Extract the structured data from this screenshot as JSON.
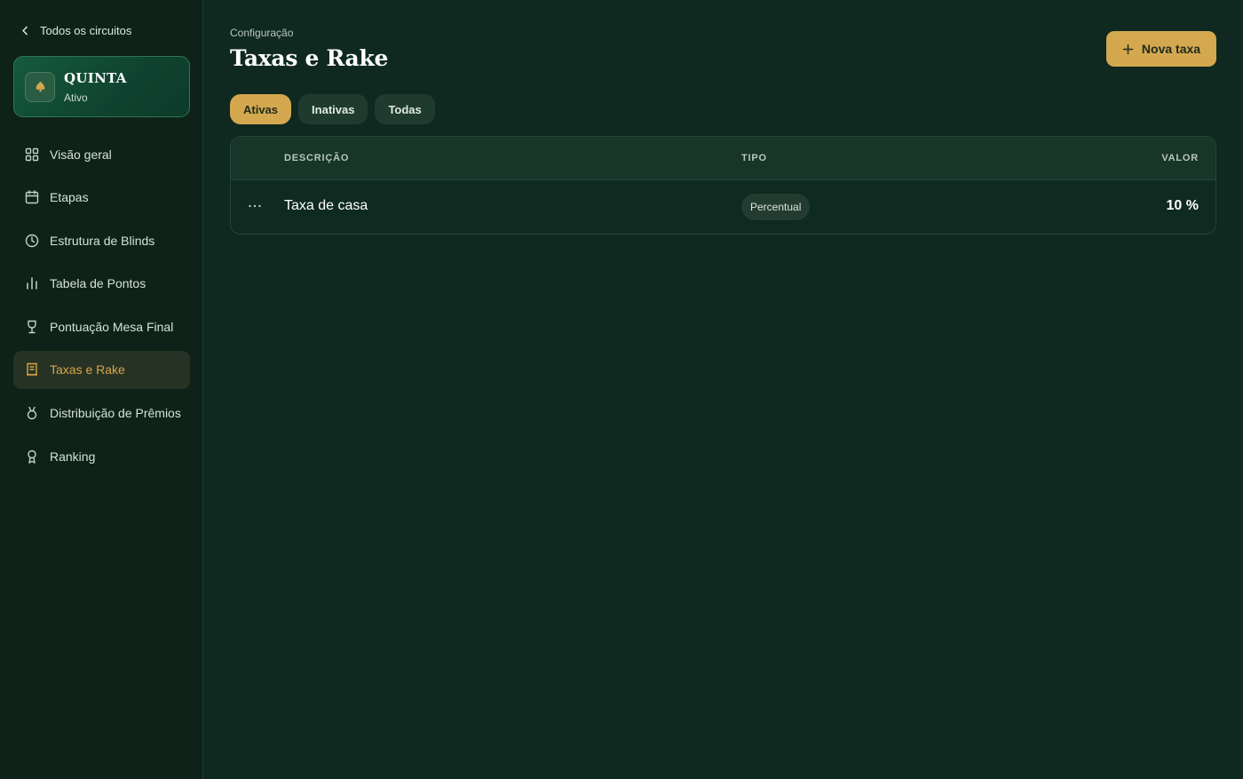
{
  "sidebar": {
    "back_label": "Todos os circuitos",
    "circuit": {
      "name": "QUINTA",
      "status": "Ativo",
      "icon": "spade-icon"
    },
    "items": [
      {
        "label": "Visão geral",
        "icon": "grid-icon"
      },
      {
        "label": "Etapas",
        "icon": "calendar-icon"
      },
      {
        "label": "Estrutura de Blinds",
        "icon": "clock-icon"
      },
      {
        "label": "Tabela de Pontos",
        "icon": "bar-chart-icon"
      },
      {
        "label": "Pontuação Mesa Final",
        "icon": "goblet-icon"
      },
      {
        "label": "Taxas e Rake",
        "icon": "receipt-icon",
        "active": true
      },
      {
        "label": "Distribuição de Prêmios",
        "icon": "medal-icon"
      },
      {
        "label": "Ranking",
        "icon": "award-icon"
      }
    ]
  },
  "header": {
    "breadcrumb": "Configuração",
    "title": "Taxas e Rake",
    "new_button": "Nova taxa"
  },
  "tabs": [
    {
      "label": "Ativas",
      "active": true
    },
    {
      "label": "Inativas"
    },
    {
      "label": "Todas"
    }
  ],
  "table": {
    "columns": {
      "description": "DESCRIÇÃO",
      "type": "TIPO",
      "value": "VALOR"
    },
    "rows": [
      {
        "description": "Taxa de casa",
        "type": "Percentual",
        "value": "10 %"
      }
    ]
  },
  "colors": {
    "accent": "#d4a84e",
    "background": "#0f2920",
    "sidebar": "#0e2219",
    "active_nav": "#263324"
  }
}
